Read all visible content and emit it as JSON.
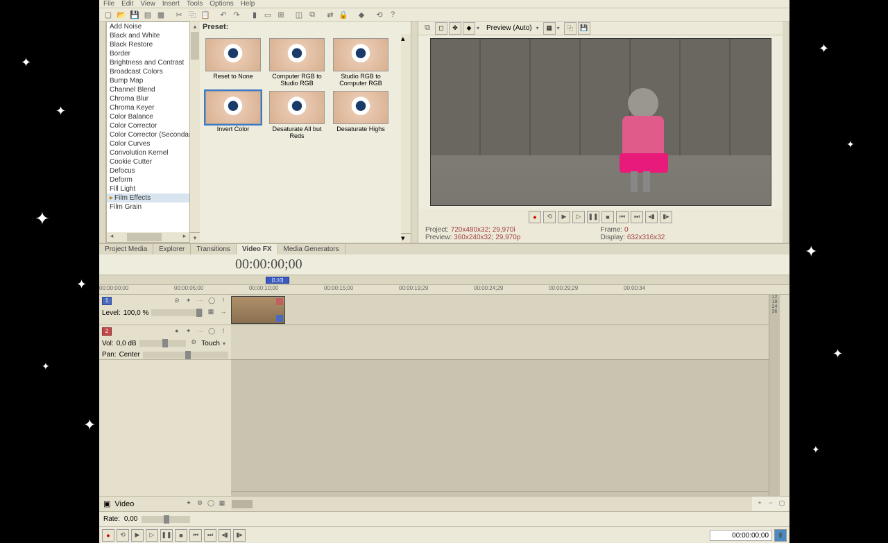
{
  "menubar": [
    "File",
    "Edit",
    "View",
    "Insert",
    "Tools",
    "Options",
    "Help"
  ],
  "toolbar_icons": [
    "new",
    "open",
    "save",
    "props",
    "render",
    "",
    "cut",
    "copy",
    "paste",
    "",
    "undo",
    "redo",
    "",
    "marker",
    "region",
    "snap",
    "",
    "group1",
    "group2",
    "",
    "ripple",
    "lock",
    "",
    "obj",
    "",
    "net",
    "help"
  ],
  "fx_list": [
    "Add Noise",
    "Black and White",
    "Black Restore",
    "Border",
    "Brightness and Contrast",
    "Broadcast Colors",
    "Bump Map",
    "Channel Blend",
    "Chroma Blur",
    "Chroma Keyer",
    "Color Balance",
    "Color Corrector",
    "Color Corrector (Secondar",
    "Color Curves",
    "Convolution Kernel",
    "Cookie Cutter",
    "Defocus",
    "Deform",
    "Fill Light",
    "Film Effects",
    "Film Grain"
  ],
  "fx_selected_index": 19,
  "preset_label": "Preset:",
  "presets": [
    {
      "label": "Reset to None"
    },
    {
      "label": "Computer RGB to Studio RGB"
    },
    {
      "label": "Studio RGB to Computer RGB"
    },
    {
      "label": "Invert Color",
      "selected": true
    },
    {
      "label": "Desaturate All but Reds"
    },
    {
      "label": "Desaturate Highs"
    }
  ],
  "tabs": [
    {
      "label": "Project Media"
    },
    {
      "label": "Explorer"
    },
    {
      "label": "Transitions"
    },
    {
      "label": "Video FX",
      "active": true
    },
    {
      "label": "Media Generators"
    }
  ],
  "preview": {
    "mode": "Preview (Auto)",
    "project_l": "Project:",
    "project_v": "720x480x32; 29,970i",
    "preview_l": "Preview:",
    "preview_v": "360x240x32; 29,970p",
    "frame_l": "Frame:",
    "frame_v": "0",
    "display_l": "Display:",
    "display_v": "632x316x32"
  },
  "timecode": "00:00:00;00",
  "loop_label": "|1;10|",
  "ruler": [
    "00:00:00;00",
    "00:00:05;00",
    "00:00:10;00",
    "00:00:15;00",
    "00:00:19;29",
    "00:00:24;29",
    "00:00:29;29",
    "00:00:34"
  ],
  "track1": {
    "num": "1",
    "level_l": "Level:",
    "level_v": "100,0 %"
  },
  "track2": {
    "num": "2",
    "vol_l": "Vol:",
    "vol_v": "0,0 dB",
    "touch": "Touch",
    "pan_l": "Pan:",
    "pan_v": "Center"
  },
  "bottom_tab": "Video",
  "rate_l": "Rate:",
  "rate_v": "0,00",
  "tc2": "00:00:00;00"
}
